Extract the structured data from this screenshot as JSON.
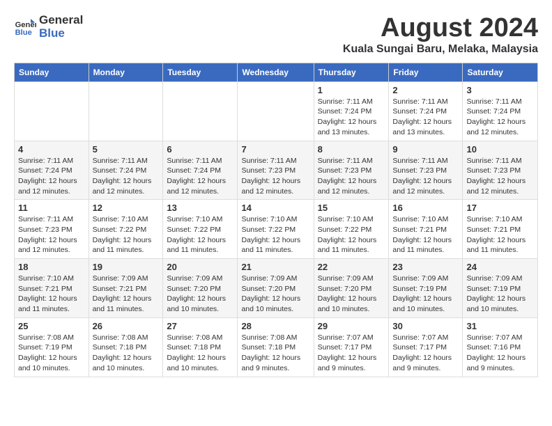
{
  "header": {
    "logo_line1": "General",
    "logo_line2": "Blue",
    "title": "August 2024",
    "subtitle": "Kuala Sungai Baru, Melaka, Malaysia"
  },
  "days_of_week": [
    "Sunday",
    "Monday",
    "Tuesday",
    "Wednesday",
    "Thursday",
    "Friday",
    "Saturday"
  ],
  "weeks": [
    [
      {
        "day": "",
        "sunrise": "",
        "sunset": "",
        "daylight": ""
      },
      {
        "day": "",
        "sunrise": "",
        "sunset": "",
        "daylight": ""
      },
      {
        "day": "",
        "sunrise": "",
        "sunset": "",
        "daylight": ""
      },
      {
        "day": "",
        "sunrise": "",
        "sunset": "",
        "daylight": ""
      },
      {
        "day": "1",
        "sunrise": "Sunrise: 7:11 AM",
        "sunset": "Sunset: 7:24 PM",
        "daylight": "Daylight: 12 hours and 13 minutes."
      },
      {
        "day": "2",
        "sunrise": "Sunrise: 7:11 AM",
        "sunset": "Sunset: 7:24 PM",
        "daylight": "Daylight: 12 hours and 13 minutes."
      },
      {
        "day": "3",
        "sunrise": "Sunrise: 7:11 AM",
        "sunset": "Sunset: 7:24 PM",
        "daylight": "Daylight: 12 hours and 12 minutes."
      }
    ],
    [
      {
        "day": "4",
        "sunrise": "Sunrise: 7:11 AM",
        "sunset": "Sunset: 7:24 PM",
        "daylight": "Daylight: 12 hours and 12 minutes."
      },
      {
        "day": "5",
        "sunrise": "Sunrise: 7:11 AM",
        "sunset": "Sunset: 7:24 PM",
        "daylight": "Daylight: 12 hours and 12 minutes."
      },
      {
        "day": "6",
        "sunrise": "Sunrise: 7:11 AM",
        "sunset": "Sunset: 7:24 PM",
        "daylight": "Daylight: 12 hours and 12 minutes."
      },
      {
        "day": "7",
        "sunrise": "Sunrise: 7:11 AM",
        "sunset": "Sunset: 7:23 PM",
        "daylight": "Daylight: 12 hours and 12 minutes."
      },
      {
        "day": "8",
        "sunrise": "Sunrise: 7:11 AM",
        "sunset": "Sunset: 7:23 PM",
        "daylight": "Daylight: 12 hours and 12 minutes."
      },
      {
        "day": "9",
        "sunrise": "Sunrise: 7:11 AM",
        "sunset": "Sunset: 7:23 PM",
        "daylight": "Daylight: 12 hours and 12 minutes."
      },
      {
        "day": "10",
        "sunrise": "Sunrise: 7:11 AM",
        "sunset": "Sunset: 7:23 PM",
        "daylight": "Daylight: 12 hours and 12 minutes."
      }
    ],
    [
      {
        "day": "11",
        "sunrise": "Sunrise: 7:11 AM",
        "sunset": "Sunset: 7:23 PM",
        "daylight": "Daylight: 12 hours and 12 minutes."
      },
      {
        "day": "12",
        "sunrise": "Sunrise: 7:10 AM",
        "sunset": "Sunset: 7:22 PM",
        "daylight": "Daylight: 12 hours and 11 minutes."
      },
      {
        "day": "13",
        "sunrise": "Sunrise: 7:10 AM",
        "sunset": "Sunset: 7:22 PM",
        "daylight": "Daylight: 12 hours and 11 minutes."
      },
      {
        "day": "14",
        "sunrise": "Sunrise: 7:10 AM",
        "sunset": "Sunset: 7:22 PM",
        "daylight": "Daylight: 12 hours and 11 minutes."
      },
      {
        "day": "15",
        "sunrise": "Sunrise: 7:10 AM",
        "sunset": "Sunset: 7:22 PM",
        "daylight": "Daylight: 12 hours and 11 minutes."
      },
      {
        "day": "16",
        "sunrise": "Sunrise: 7:10 AM",
        "sunset": "Sunset: 7:21 PM",
        "daylight": "Daylight: 12 hours and 11 minutes."
      },
      {
        "day": "17",
        "sunrise": "Sunrise: 7:10 AM",
        "sunset": "Sunset: 7:21 PM",
        "daylight": "Daylight: 12 hours and 11 minutes."
      }
    ],
    [
      {
        "day": "18",
        "sunrise": "Sunrise: 7:10 AM",
        "sunset": "Sunset: 7:21 PM",
        "daylight": "Daylight: 12 hours and 11 minutes."
      },
      {
        "day": "19",
        "sunrise": "Sunrise: 7:09 AM",
        "sunset": "Sunset: 7:21 PM",
        "daylight": "Daylight: 12 hours and 11 minutes."
      },
      {
        "day": "20",
        "sunrise": "Sunrise: 7:09 AM",
        "sunset": "Sunset: 7:20 PM",
        "daylight": "Daylight: 12 hours and 10 minutes."
      },
      {
        "day": "21",
        "sunrise": "Sunrise: 7:09 AM",
        "sunset": "Sunset: 7:20 PM",
        "daylight": "Daylight: 12 hours and 10 minutes."
      },
      {
        "day": "22",
        "sunrise": "Sunrise: 7:09 AM",
        "sunset": "Sunset: 7:20 PM",
        "daylight": "Daylight: 12 hours and 10 minutes."
      },
      {
        "day": "23",
        "sunrise": "Sunrise: 7:09 AM",
        "sunset": "Sunset: 7:19 PM",
        "daylight": "Daylight: 12 hours and 10 minutes."
      },
      {
        "day": "24",
        "sunrise": "Sunrise: 7:09 AM",
        "sunset": "Sunset: 7:19 PM",
        "daylight": "Daylight: 12 hours and 10 minutes."
      }
    ],
    [
      {
        "day": "25",
        "sunrise": "Sunrise: 7:08 AM",
        "sunset": "Sunset: 7:19 PM",
        "daylight": "Daylight: 12 hours and 10 minutes."
      },
      {
        "day": "26",
        "sunrise": "Sunrise: 7:08 AM",
        "sunset": "Sunset: 7:18 PM",
        "daylight": "Daylight: 12 hours and 10 minutes."
      },
      {
        "day": "27",
        "sunrise": "Sunrise: 7:08 AM",
        "sunset": "Sunset: 7:18 PM",
        "daylight": "Daylight: 12 hours and 10 minutes."
      },
      {
        "day": "28",
        "sunrise": "Sunrise: 7:08 AM",
        "sunset": "Sunset: 7:18 PM",
        "daylight": "Daylight: 12 hours and 9 minutes."
      },
      {
        "day": "29",
        "sunrise": "Sunrise: 7:07 AM",
        "sunset": "Sunset: 7:17 PM",
        "daylight": "Daylight: 12 hours and 9 minutes."
      },
      {
        "day": "30",
        "sunrise": "Sunrise: 7:07 AM",
        "sunset": "Sunset: 7:17 PM",
        "daylight": "Daylight: 12 hours and 9 minutes."
      },
      {
        "day": "31",
        "sunrise": "Sunrise: 7:07 AM",
        "sunset": "Sunset: 7:16 PM",
        "daylight": "Daylight: 12 hours and 9 minutes."
      }
    ]
  ]
}
